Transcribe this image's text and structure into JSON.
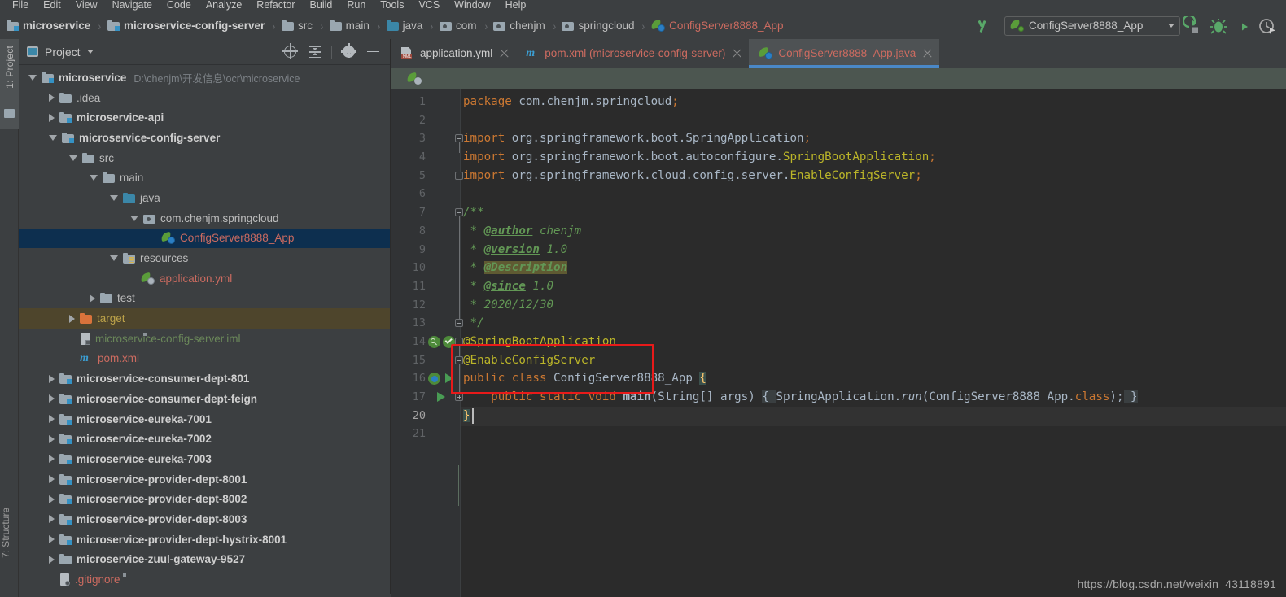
{
  "menu": {
    "items": [
      "File",
      "Edit",
      "View",
      "Navigate",
      "Code",
      "Analyze",
      "Refactor",
      "Build",
      "Run",
      "Tools",
      "VCS",
      "Window",
      "Help"
    ]
  },
  "navbar": {
    "breadcrumbs": [
      {
        "label": "microservice",
        "icon": "module-folder-icon",
        "style": "bold"
      },
      {
        "label": "microservice-config-server",
        "icon": "module-folder-icon",
        "style": "bold"
      },
      {
        "label": "src",
        "icon": "folder-icon",
        "style": "plain"
      },
      {
        "label": "main",
        "icon": "folder-icon",
        "style": "plain"
      },
      {
        "label": "java",
        "icon": "source-folder-icon",
        "style": "plain"
      },
      {
        "label": "com",
        "icon": "package-icon",
        "style": "plain"
      },
      {
        "label": "chenjm",
        "icon": "package-icon",
        "style": "plain"
      },
      {
        "label": "springcloud",
        "icon": "package-icon",
        "style": "plain"
      },
      {
        "label": "ConfigServer8888_App",
        "icon": "spring-boot-class-icon",
        "style": "red"
      }
    ],
    "separator": "›",
    "build_button": "build-hammer-icon",
    "run_config": {
      "name": "ConfigServer8888_App",
      "icon": "spring-boot-run-config-icon",
      "dropdown": "chevron-down-icon"
    },
    "actions": [
      {
        "name": "run-button",
        "icon": "run-icon",
        "color": "#59a869"
      },
      {
        "name": "debug-button",
        "icon": "debug-bug-icon",
        "color": "#59a869"
      },
      {
        "name": "run-with-coverage-button",
        "icon": "coverage-icon",
        "color": "#59a869"
      },
      {
        "name": "profiler-button",
        "icon": "profiler-clock-icon",
        "color": "#a6a6a6"
      }
    ]
  },
  "left_strip": {
    "project_tab": "1: Project",
    "structure_tab": "7: Structure",
    "favorites_icon": "favorites-folder-icon"
  },
  "project_panel": {
    "title": "Project",
    "view_dropdown": "chevron-down-icon",
    "toolbar": [
      {
        "name": "scroll-from-source-button",
        "icon": "crosshair-target-icon"
      },
      {
        "name": "collapse-all-button",
        "icon": "collapse-all-icon"
      },
      {
        "name": "settings-button",
        "icon": "gear-icon"
      },
      {
        "name": "hide-panel-button",
        "icon": "minus-icon"
      }
    ],
    "tree": [
      {
        "label": "microservice",
        "path": "D:\\chenjm\\开发信息\\ocr\\microservice",
        "indent": 0,
        "arrow": "open",
        "icon": "module-folder-icon",
        "style": "bold"
      },
      {
        "label": ".idea",
        "indent": 1,
        "arrow": "closed",
        "icon": "folder-icon",
        "style": "plain"
      },
      {
        "label": "microservice-api",
        "indent": 1,
        "arrow": "closed",
        "icon": "module-folder-icon",
        "style": "bold"
      },
      {
        "label": "microservice-config-server",
        "indent": 1,
        "arrow": "open",
        "icon": "module-folder-icon",
        "style": "bold"
      },
      {
        "label": "src",
        "indent": 2,
        "arrow": "open",
        "icon": "folder-icon",
        "style": "plain"
      },
      {
        "label": "main",
        "indent": 3,
        "arrow": "open",
        "icon": "folder-icon",
        "style": "plain"
      },
      {
        "label": "java",
        "indent": 4,
        "arrow": "open",
        "icon": "source-folder-icon",
        "style": "plain"
      },
      {
        "label": "com.chenjm.springcloud",
        "indent": 5,
        "arrow": "open",
        "icon": "package-icon",
        "style": "plain"
      },
      {
        "label": "ConfigServer8888_App",
        "indent": 6,
        "arrow": "none",
        "icon": "spring-boot-class-icon",
        "style": "red",
        "selected": true
      },
      {
        "label": "resources",
        "indent": 4,
        "arrow": "open",
        "icon": "resources-folder-icon",
        "style": "plain"
      },
      {
        "label": "application.yml",
        "indent": 5,
        "arrow": "none",
        "icon": "spring-yaml-icon",
        "style": "red"
      },
      {
        "label": "test",
        "indent": 3,
        "arrow": "closed",
        "icon": "folder-icon",
        "style": "plain"
      },
      {
        "label": "target",
        "indent": 2,
        "arrow": "closed",
        "icon": "excluded-folder-icon",
        "style": "olive",
        "highlighted": true
      },
      {
        "label": "microservice-config-server.iml",
        "indent": 2,
        "arrow": "none",
        "icon": "iml-file-icon",
        "style": "green"
      },
      {
        "label": "pom.xml",
        "indent": 2,
        "arrow": "none",
        "icon": "maven-pom-icon",
        "style": "red"
      },
      {
        "label": "microservice-consumer-dept-801",
        "indent": 1,
        "arrow": "closed",
        "icon": "module-folder-icon",
        "style": "bold"
      },
      {
        "label": "microservice-consumer-dept-feign",
        "indent": 1,
        "arrow": "closed",
        "icon": "module-folder-icon",
        "style": "bold"
      },
      {
        "label": "microservice-eureka-7001",
        "indent": 1,
        "arrow": "closed",
        "icon": "module-folder-icon",
        "style": "bold"
      },
      {
        "label": "microservice-eureka-7002",
        "indent": 1,
        "arrow": "closed",
        "icon": "module-folder-icon",
        "style": "bold"
      },
      {
        "label": "microservice-eureka-7003",
        "indent": 1,
        "arrow": "closed",
        "icon": "module-folder-icon",
        "style": "bold"
      },
      {
        "label": "microservice-provider-dept-8001",
        "indent": 1,
        "arrow": "closed",
        "icon": "module-folder-icon",
        "style": "bold"
      },
      {
        "label": "microservice-provider-dept-8002",
        "indent": 1,
        "arrow": "closed",
        "icon": "module-folder-icon",
        "style": "bold"
      },
      {
        "label": "microservice-provider-dept-8003",
        "indent": 1,
        "arrow": "closed",
        "icon": "module-folder-icon",
        "style": "bold"
      },
      {
        "label": "microservice-provider-dept-hystrix-8001",
        "indent": 1,
        "arrow": "closed",
        "icon": "module-folder-icon",
        "style": "bold"
      },
      {
        "label": "microservice-zuul-gateway-9527",
        "indent": 1,
        "arrow": "closed",
        "icon": "folder-icon",
        "style": "bold"
      },
      {
        "label": ".gitignore",
        "indent": 1,
        "arrow": "none",
        "icon": "gitignore-file-icon",
        "style": "red"
      }
    ]
  },
  "editor": {
    "tabs": [
      {
        "label": "application.yml",
        "icon": "yaml-file-icon",
        "color": "white",
        "active": false
      },
      {
        "label": "pom.xml (microservice-config-server)",
        "icon": "maven-pom-icon",
        "color": "red",
        "active": false
      },
      {
        "label": "ConfigServer8888_App.java",
        "icon": "spring-boot-class-icon",
        "color": "red",
        "active": true
      }
    ],
    "close_icon": "close-icon",
    "spring_banner_icon": "spring-boot-banner-icon",
    "line_numbers": [
      "1",
      "2",
      "3",
      "4",
      "5",
      "6",
      "7",
      "8",
      "9",
      "10",
      "11",
      "12",
      "13",
      "14",
      "15",
      "16",
      "17",
      "20",
      "21"
    ],
    "current_line": "20",
    "code_lines": [
      "package com.chenjm.springcloud;",
      "",
      "import org.springframework.boot.SpringApplication;",
      "import org.springframework.boot.autoconfigure.SpringBootApplication;",
      "import org.springframework.cloud.config.server.EnableConfigServer;",
      "",
      "/**",
      " * @author chenjm",
      " * @version 1.0",
      " * @Description",
      " * @since 1.0",
      " * 2020/12/30",
      " */",
      "@SpringBootApplication",
      "@EnableConfigServer",
      "public class ConfigServer8888_App {",
      "    public static void main(String[] args) { SpringApplication.run(ConfigServer8888_App.class); }",
      "}",
      ""
    ],
    "annotation": {
      "name": "red-highlight-box",
      "color": "#e81a1a"
    },
    "gutter_icons": [
      {
        "line": "14",
        "icons": [
          "spring-bean-search-icon",
          "spring-config-check-icon"
        ]
      },
      {
        "line": "16",
        "icons": [
          "spring-boot-bean-icon",
          "run-gutter-icon"
        ]
      },
      {
        "line": "17",
        "icons": [
          "run-gutter-icon"
        ]
      }
    ]
  },
  "watermark": "https://blog.csdn.net/weixin_43118891"
}
